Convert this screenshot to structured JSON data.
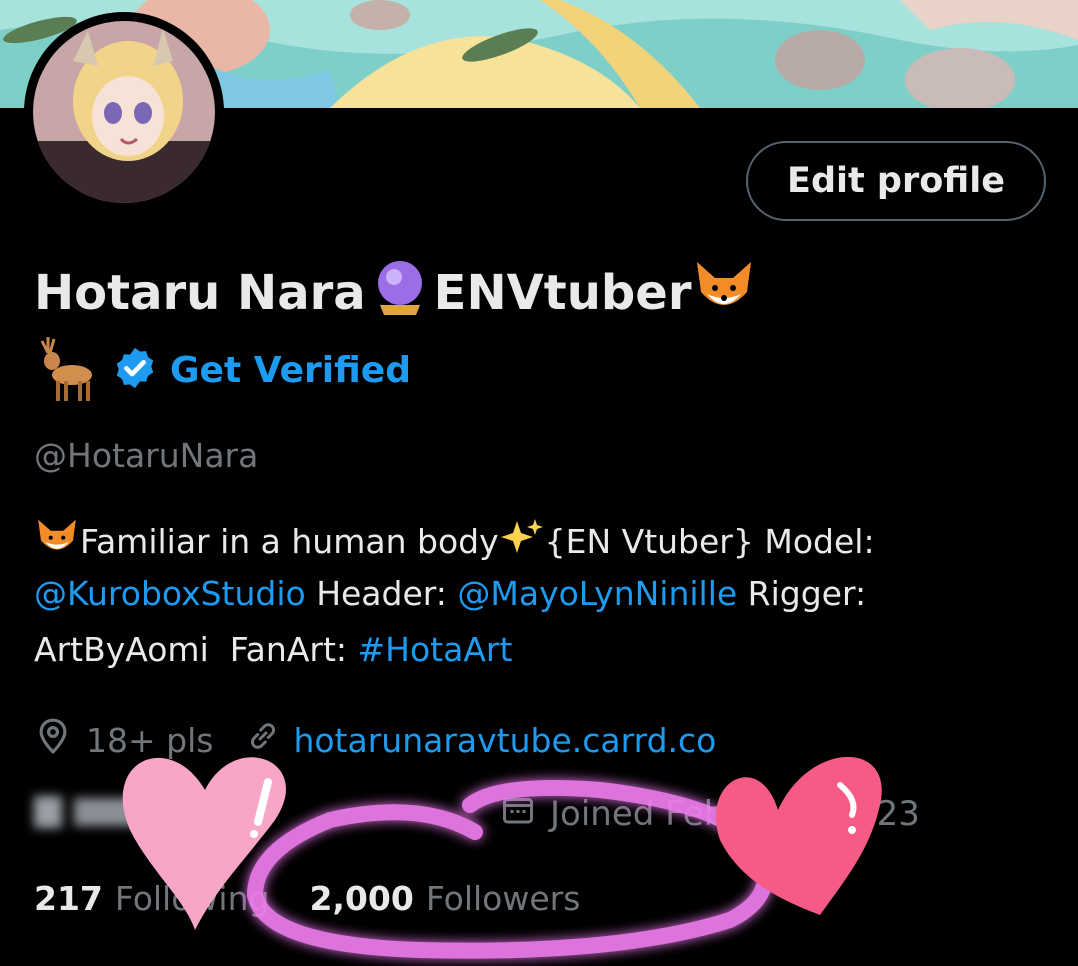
{
  "profile": {
    "edit_button_label": "Edit profile",
    "display_name": "Hotaru Nara",
    "display_name_suffix": "ENVtuber",
    "get_verified_label": "Get Verified",
    "handle": "@HotaruNara"
  },
  "bio": {
    "line1_text": "Familiar in a human body",
    "line1_after": " {EN Vtuber} Model:",
    "mention_1": "@KuroboxStudio",
    "header_label": " Header: ",
    "mention_2": "@MayoLynNinille",
    "rigger_label": " Rigger:",
    "line3_text": "ArtByAomi  FanArt: ",
    "hashtag": "#HotaArt"
  },
  "meta": {
    "location": "18+ pls",
    "website": "hotarunaravtube.carrd.co",
    "joined_prefix": "Joined Feb",
    "joined_year": "2023"
  },
  "stats": {
    "following_count": "217",
    "following_label": "Following",
    "followers_count": "2,000",
    "followers_label": "Followers"
  },
  "icons": {
    "location": "location-pin-icon",
    "link": "link-icon",
    "calendar": "calendar-icon",
    "verified": "verified-badge-icon"
  },
  "colors": {
    "accent": "#1d9bf0",
    "text": "#e7e9ea",
    "muted": "#71767b",
    "circle_highlight": "#f07df0",
    "heart_left": "#f7a6c7",
    "heart_right": "#f55b84"
  }
}
